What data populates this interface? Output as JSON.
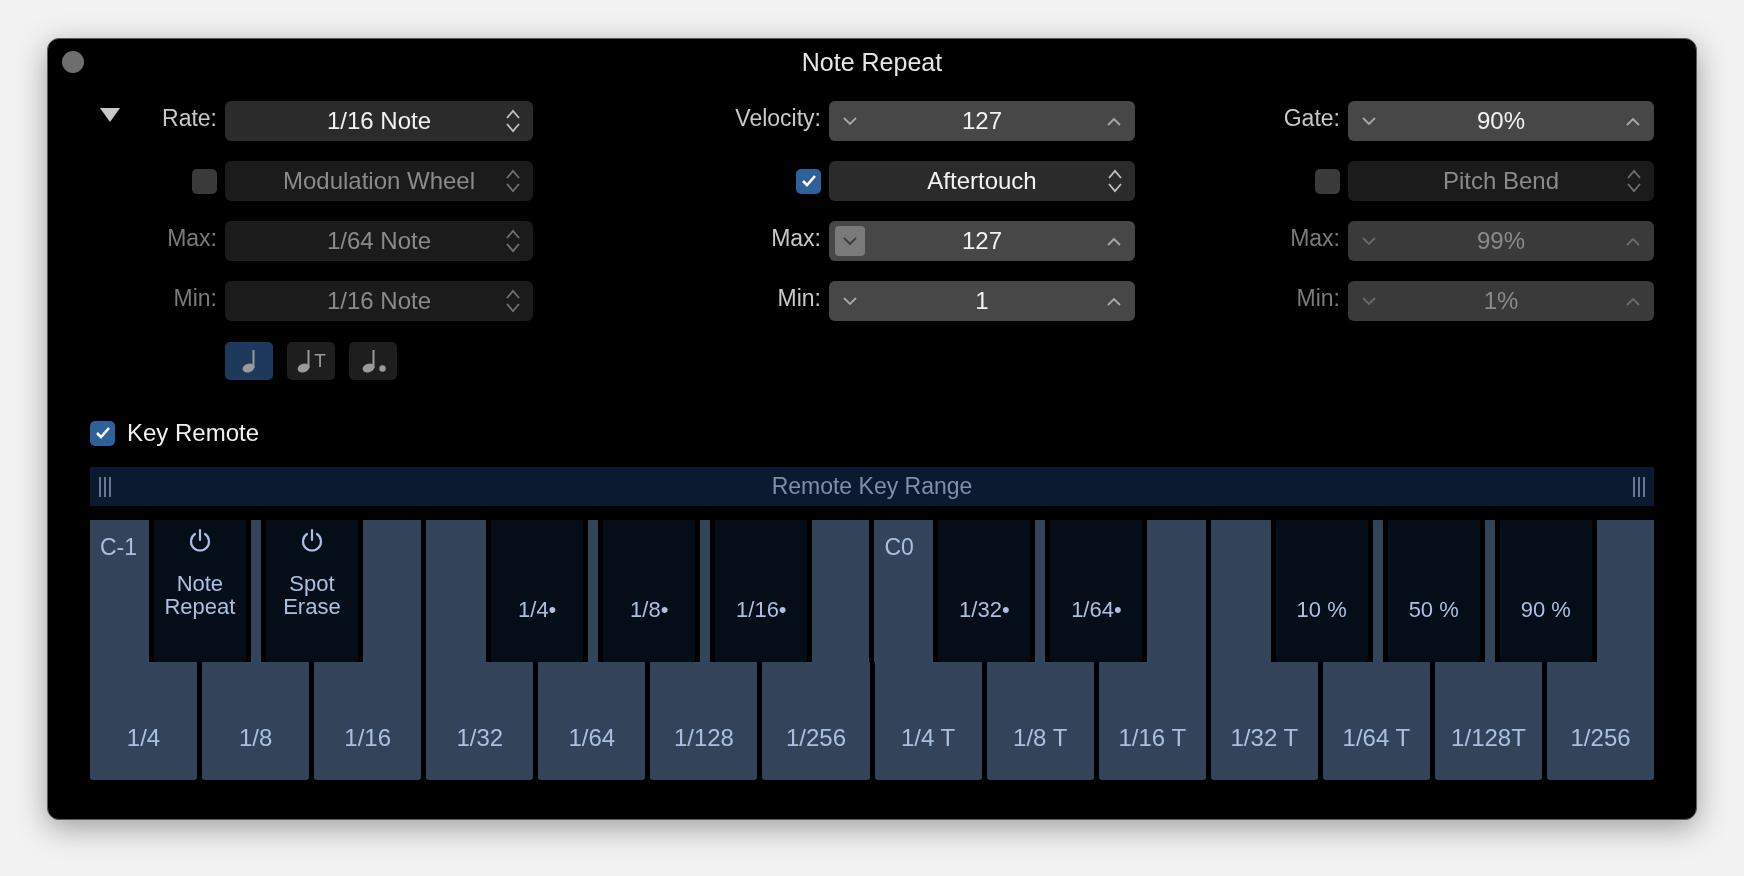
{
  "window": {
    "title": "Note Repeat"
  },
  "disclosure": {
    "expanded": true
  },
  "columns": [
    {
      "kind": "popup",
      "main": {
        "label": "Rate:",
        "value": "1/16 Note"
      },
      "modulation": {
        "checked": false,
        "source": "Modulation Wheel"
      },
      "max": {
        "label": "Max:",
        "value": "1/64 Note"
      },
      "min": {
        "label": "Min:",
        "value": "1/16 Note"
      }
    },
    {
      "kind": "stepper",
      "main": {
        "label": "Velocity:",
        "value": "127"
      },
      "modulation": {
        "checked": true,
        "source": "Aftertouch"
      },
      "max": {
        "label": "Max:",
        "value": "127",
        "down_pressed": true
      },
      "min": {
        "label": "Min:",
        "value": "1"
      }
    },
    {
      "kind": "stepper",
      "main": {
        "label": "Gate:",
        "value": "90%"
      },
      "modulation": {
        "checked": false,
        "source": "Pitch Bend"
      },
      "max": {
        "label": "Max:",
        "value": "99%"
      },
      "min": {
        "label": "Min:",
        "value": "1%"
      }
    }
  ],
  "note_buttons": [
    {
      "kind": "straight",
      "selected": true
    },
    {
      "kind": "triplet",
      "mark": "T",
      "selected": false
    },
    {
      "kind": "dotted",
      "selected": false
    }
  ],
  "key_remote": {
    "label": "Key Remote",
    "checked": true
  },
  "range_bar": {
    "label": "Remote Key Range"
  },
  "white_keys": [
    {
      "octave": "C-1",
      "label": "1/4"
    },
    {
      "label": "1/8"
    },
    {
      "label": "1/16"
    },
    {
      "label": "1/32"
    },
    {
      "label": "1/64"
    },
    {
      "label": "1/128"
    },
    {
      "label": "1/256"
    },
    {
      "octave": "C0",
      "label": "1/4 T"
    },
    {
      "label": "1/8 T"
    },
    {
      "label": "1/16 T"
    },
    {
      "label": "1/32 T"
    },
    {
      "label": "1/64 T"
    },
    {
      "label": "1/128T"
    },
    {
      "label": "1/256"
    }
  ],
  "black_keys": [
    {
      "kind": "switch",
      "label": "Note Repeat"
    },
    {
      "kind": "switch",
      "label": "Spot Erase"
    },
    {
      "kind": "value",
      "label": "1/4•"
    },
    {
      "kind": "value",
      "label": "1/8•"
    },
    {
      "kind": "value",
      "label": "1/16•"
    },
    {
      "kind": "value",
      "label": "1/32•"
    },
    {
      "kind": "value",
      "label": "1/64•"
    },
    {
      "kind": "value",
      "label": "10 %"
    },
    {
      "kind": "value",
      "label": "50 %"
    },
    {
      "kind": "value",
      "label": "90 %"
    }
  ]
}
